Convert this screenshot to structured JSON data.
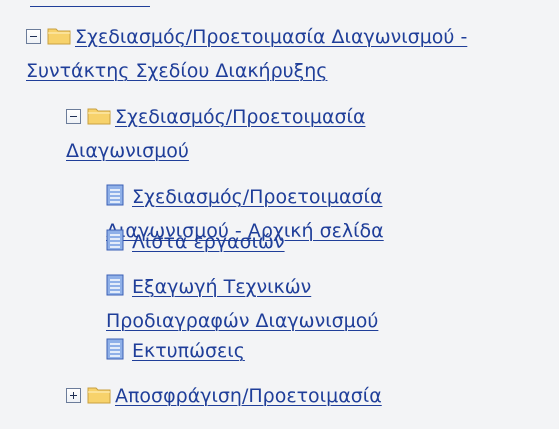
{
  "tree": {
    "items": [
      {
        "toggle": "minus",
        "icon": "folder-icon",
        "label": "Σχεδιασμός/Προετοιμασία Διαγωνισμού - Συντάκτης Σχεδίου Διακήρυξης"
      },
      {
        "toggle": "minus",
        "icon": "folder-icon",
        "label": "Σχεδιασμός/Προετοιμασία Διαγωνισμού"
      },
      {
        "icon": "page-icon",
        "label": "Σχεδιασμός/Προετοιμασία Διαγωνισμού - Αρχική σελίδα"
      },
      {
        "icon": "page-icon",
        "label": "Λίστα εργασιών"
      },
      {
        "icon": "page-icon",
        "label": "Εξαγωγή Τεχνικών Προδιαγραφών Διαγωνισμού"
      },
      {
        "icon": "page-icon",
        "label": "Εκτυπώσεις"
      },
      {
        "toggle": "plus",
        "icon": "folder-icon",
        "label": "Αποσφράγιση/Προετοιμασία"
      }
    ]
  },
  "colors": {
    "link": "#1f3e99",
    "panel_background": "#f3f4f6",
    "folder_fill": "#f7d26b",
    "page_fill": "#8fb0e8"
  }
}
